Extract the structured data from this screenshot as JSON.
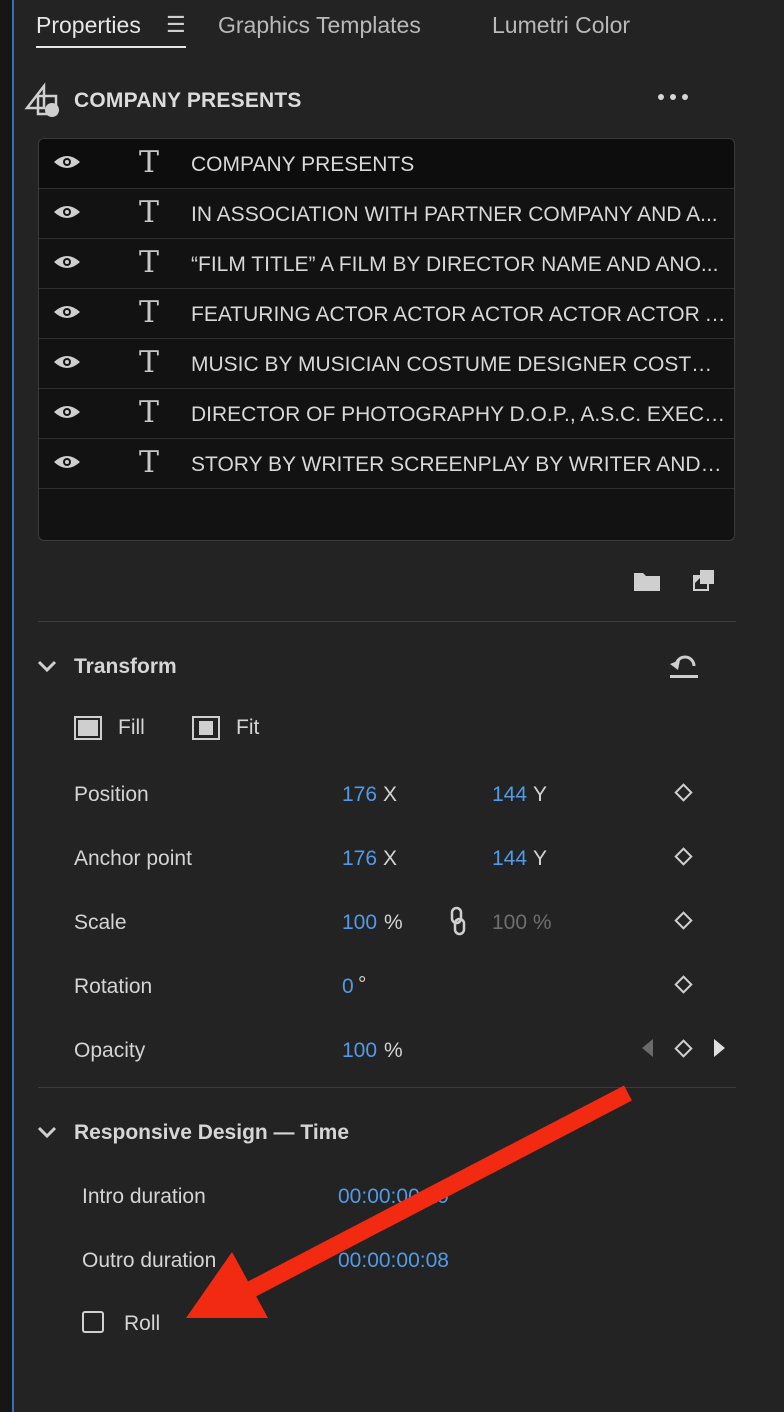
{
  "tabs": [
    {
      "label": "Properties",
      "active": true
    },
    {
      "label": "Graphics Templates",
      "active": false
    },
    {
      "label": "Lumetri Color",
      "active": false
    }
  ],
  "tab_menu_icon": "hamburger-icon",
  "header": {
    "title": "COMPANY PRESENTS",
    "icon": "shapes-icon",
    "more_icon": "more-horizontal-icon"
  },
  "layers": [
    {
      "name": "COMPANY PRESENTS",
      "visible": true,
      "type": "text"
    },
    {
      "name": "IN ASSOCIATION WITH PARTNER COMPANY AND A...",
      "visible": true,
      "type": "text"
    },
    {
      "name": "“FILM TITLE” A FILM BY DIRECTOR NAME AND ANO...",
      "visible": true,
      "type": "text"
    },
    {
      "name": "FEATURING ACTOR ACTOR ACTOR ACTOR ACTOR A...",
      "visible": true,
      "type": "text"
    },
    {
      "name": "MUSIC BY MUSICIAN COSTUME DESIGNER COSTUM...",
      "visible": true,
      "type": "text"
    },
    {
      "name": "DIRECTOR OF PHOTOGRAPHY D.O.P., A.S.C.  EXECUTI...",
      "visible": true,
      "type": "text"
    },
    {
      "name": "STORY BY WRITER SCREENPLAY BY WRITER AND WR...",
      "visible": true,
      "type": "text"
    }
  ],
  "layer_actions": {
    "folder_icon": "folder-icon",
    "new_layer_icon": "new-layer-icon"
  },
  "transform": {
    "title": "Transform",
    "fill_label": "Fill",
    "fit_label": "Fit",
    "position": {
      "label": "Position",
      "x": "176",
      "x_unit": "X",
      "y": "144",
      "y_unit": "Y"
    },
    "anchor": {
      "label": "Anchor point",
      "x": "176",
      "x_unit": "X",
      "y": "144",
      "y_unit": "Y"
    },
    "scale": {
      "label": "Scale",
      "value": "100",
      "unit": "%",
      "value2": "100 %"
    },
    "rotation": {
      "label": "Rotation",
      "value": "0",
      "unit": "°"
    },
    "opacity": {
      "label": "Opacity",
      "value": "100",
      "unit": "%"
    }
  },
  "responsive": {
    "title": "Responsive Design — Time",
    "intro_label": "Intro duration",
    "intro_value": "00:00:00:19",
    "outro_label": "Outro duration",
    "outro_value": "00:00:00:08",
    "roll_label": "Roll",
    "roll_checked": false
  },
  "colors": {
    "accent_blue": "#4f9be8",
    "annotation_red": "#f22a12",
    "panel_border": "#3a6fb8"
  }
}
